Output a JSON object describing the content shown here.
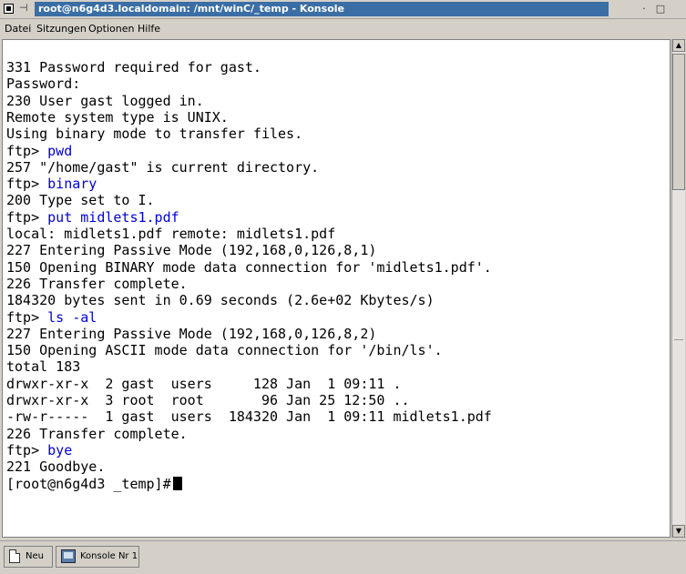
{
  "window": {
    "title": "root@n6g4d3.localdomain: /mnt/winC/_temp - Konsole"
  },
  "titlebar": {
    "minimize_symbol": "·",
    "maximize_symbol": "□"
  },
  "menubar": {
    "items": [
      "Datei",
      "Sitzungen",
      "Optionen",
      "Hilfe"
    ]
  },
  "terminal": {
    "prompt": "ftp>",
    "lines": [
      "331 Password required for gast.",
      "Password:",
      "230 User gast logged in.",
      "Remote system type is UNIX.",
      "Using binary mode to transfer files.",
      "pwd",
      "257 \"/home/gast\" is current directory.",
      "binary",
      "200 Type set to I.",
      "put midlets1.pdf",
      "local: midlets1.pdf remote: midlets1.pdf",
      "227 Entering Passive Mode (192,168,0,126,8,1)",
      "150 Opening BINARY mode data connection for 'midlets1.pdf'.",
      "226 Transfer complete.",
      "184320 bytes sent in 0.69 seconds (2.6e+02 Kbytes/s)",
      "ls -al",
      "227 Entering Passive Mode (192,168,0,126,8,2)",
      "150 Opening ASCII mode data connection for '/bin/ls'.",
      "total 183",
      "drwxr-xr-x  2 gast  users     128 Jan  1 09:11 .",
      "drwxr-xr-x  3 root  root       96 Jan 25 12:50 ..",
      "-rw-r-----  1 gast  users  184320 Jan  1 09:11 midlets1.pdf",
      "226 Transfer complete.",
      "bye",
      "221 Goodbye.",
      "[root@n6g4d3 _temp]#"
    ]
  },
  "tabbar": {
    "new_label": "Neu",
    "session_label": "Konsole Nr 1"
  }
}
